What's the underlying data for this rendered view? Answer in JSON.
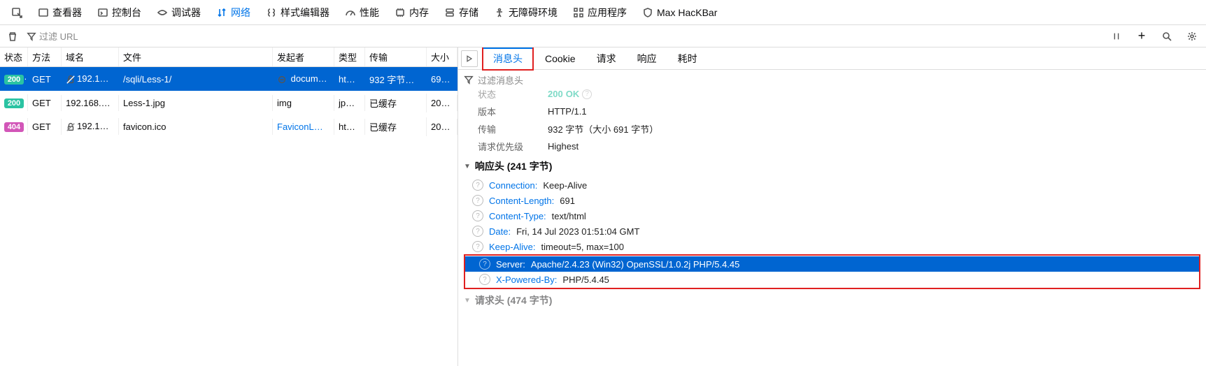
{
  "top_tools": {
    "inspector": "查看器",
    "console": "控制台",
    "debugger": "调试器",
    "network": "网络",
    "style_editor": "样式编辑器",
    "performance": "性能",
    "memory": "内存",
    "storage": "存储",
    "accessibility": "无障碍环境",
    "application": "应用程序",
    "hackbar": "Max HacKBar"
  },
  "filter_bar": {
    "placeholder": "过滤 URL"
  },
  "net_columns": {
    "status": "状态",
    "method": "方法",
    "domain": "域名",
    "file": "文件",
    "initiator": "发起者",
    "type": "类型",
    "transfer": "传输",
    "size": "大小"
  },
  "net_rows": [
    {
      "status": "200",
      "status_class": "status-200",
      "method": "GET",
      "domain": "192.1…",
      "file": "/sqli/Less-1/",
      "initiator": "document",
      "initiator_icon": true,
      "type": "ht…",
      "transfer": "932 字节…",
      "size": "69…",
      "selected": true,
      "insecure": true
    },
    {
      "status": "200",
      "status_class": "status-200",
      "method": "GET",
      "domain": "192.168.…",
      "file": "Less-1.jpg",
      "initiator": "img",
      "type": "jp…",
      "transfer": "已缓存",
      "size": "20…"
    },
    {
      "status": "404",
      "status_class": "status-404",
      "method": "GET",
      "domain": "192.1…",
      "file": "favicon.ico",
      "initiator": "FaviconL…",
      "initiator_link": true,
      "type": "ht…",
      "transfer": "已缓存",
      "size": "20…",
      "insecure": true
    }
  ],
  "details_tabs": {
    "headers": "消息头",
    "cookie": "Cookie",
    "request": "请求",
    "response": "响应",
    "timing": "耗时"
  },
  "filter_headers_placeholder": "过滤消息头",
  "summary": {
    "status_label": "状态",
    "status_code": "200",
    "status_text": "OK",
    "version_label": "版本",
    "version_value": "HTTP/1.1",
    "transfer_label": "传输",
    "transfer_value": "932 字节（大小 691 字节）",
    "priority_label": "请求优先级",
    "priority_value": "Highest"
  },
  "response_section_title": "响应头 (241 字节)",
  "response_headers": [
    {
      "name": "Connection:",
      "value": "Keep-Alive"
    },
    {
      "name": "Content-Length:",
      "value": "691"
    },
    {
      "name": "Content-Type:",
      "value": "text/html"
    },
    {
      "name": "Date:",
      "value": "Fri, 14 Jul 2023 01:51:04 GMT"
    },
    {
      "name": "Keep-Alive:",
      "value": "timeout=5, max=100"
    }
  ],
  "highlighted_headers": [
    {
      "name": "Server:",
      "value": "Apache/2.4.23 (Win32) OpenSSL/1.0.2j PHP/5.4.45",
      "hl": true
    },
    {
      "name": "X-Powered-By:",
      "value": "PHP/5.4.45"
    }
  ],
  "request_section_title": "请求头 (474 字节)"
}
